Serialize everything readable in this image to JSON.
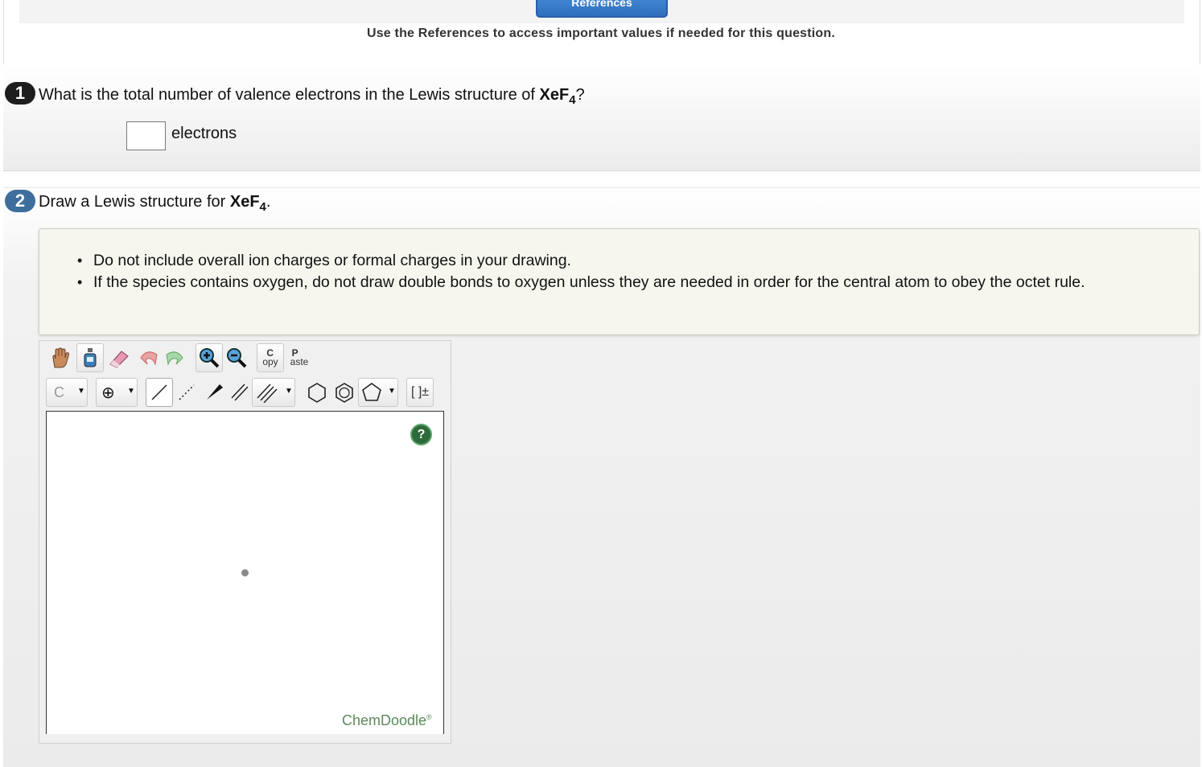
{
  "header": {
    "references_button": "References",
    "references_hint": "Use the References to access important values if needed for this question."
  },
  "question1": {
    "number": "1",
    "text_prefix": "What is the total number of valence electrons in the Lewis structure of ",
    "formula_main": "XeF",
    "formula_sub": "4",
    "text_suffix": "?",
    "answer_value": "",
    "unit": "electrons"
  },
  "question2": {
    "number": "2",
    "text_prefix": "Draw a Lewis structure for ",
    "formula_main": "XeF",
    "formula_sub": "4",
    "text_suffix": ".",
    "instructions": [
      "Do not include overall ion charges or formal charges in your drawing.",
      "If the species contains oxygen, do not draw double bonds to oxygen unless they are needed in order for the central atom to obey the octet rule."
    ]
  },
  "editor": {
    "toolbar_row1": [
      "hand-icon",
      "bottle-icon",
      "eraser-icon",
      "undo-icon",
      "redo-icon",
      "zoom-in-icon",
      "zoom-out-icon",
      "copy-button",
      "paste-button"
    ],
    "copy_top": "C",
    "copy_bottom": "opy",
    "paste_top": "P",
    "paste_bottom": "aste",
    "element_selected": "C",
    "charge_symbol": "⊕",
    "bracket_label": "[ ]±",
    "help_label": "?",
    "watermark": "ChemDoodle",
    "watermark_reg": "®"
  }
}
